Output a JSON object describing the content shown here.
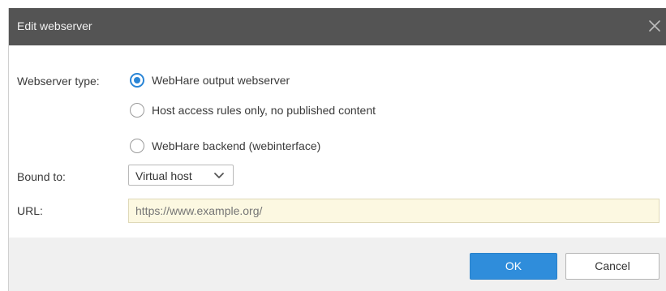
{
  "dialog": {
    "title": "Edit webserver",
    "close_icon": "close-icon"
  },
  "form": {
    "webserver_type_label": "Webserver type:",
    "webserver_type_options": [
      {
        "label": "WebHare output webserver",
        "selected": true
      },
      {
        "label": "Host access rules only, no published content",
        "selected": false
      },
      {
        "label": "WebHare backend (webinterface)",
        "selected": false
      }
    ],
    "bound_to_label": "Bound to:",
    "bound_to_value": "Virtual host",
    "bound_to_icon": "chevron-down-icon",
    "url_label": "URL:",
    "url_placeholder": "https://www.example.org/",
    "url_value": ""
  },
  "buttons": {
    "ok_label": "OK",
    "cancel_label": "Cancel"
  },
  "colors": {
    "titlebar": "#545454",
    "accent": "#2f8ddb",
    "url_field_background": "#fcf8e1",
    "footer": "#f0f0f0"
  }
}
